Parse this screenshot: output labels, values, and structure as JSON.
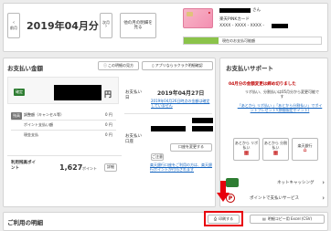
{
  "top": {
    "prev_month": "前月",
    "current_month": "2019年04月分",
    "next_month": "次月",
    "other_month": "他の月の明細を見る",
    "card_holder_suffix": "さん",
    "card_name": "楽天PINKカード",
    "card_number": "XXXX - XXXX - XXXX -",
    "card_status_text": "現在のお支払可能額"
  },
  "payment": {
    "title": "お支払い金額",
    "how_to_view_button": "この明細の見方",
    "app_button": "アプリならラクラク明細確認",
    "confirmed_badge": "確定",
    "yen": "円",
    "adjustment_badge": "残高",
    "adjustment_label": "調整額（キャンセル等）",
    "points_label": "ポイント支払い額",
    "cash_label": "現金支払",
    "zero_yen": "0 円",
    "points_title": "利用残高ポイント",
    "points_value": "1,627",
    "points_unit": "ポイント",
    "points_detail_button": "詳細",
    "due_date_label": "お支払い日",
    "due_date_value": "2019年04月27日",
    "due_note_link": "2019年04月26日時点の金額は確定していません",
    "account_label": "お支払い口座",
    "account_change_button": "口座を変更する",
    "account_detail_button": "ご注意",
    "bank_note_link": "楽天銀行口座をご利用の方は、楽天銀行ポイントが付与されます"
  },
  "support": {
    "title": "お支払いサポート",
    "alert_text": "04月分の金額変更は締め切りました",
    "info_text": "リボ払い、分割払いは05月分から変更可能です",
    "campaign_link": "「あとから リボ払い 」「あとから分割払い」でポイントプレゼント!(期間限定ポイント)",
    "tile_1": "あとから リボ払い",
    "tile_2": "あとから 分割払い",
    "tile_3": "楽天銀行",
    "net_cashing": "ネットキャッシング",
    "point_service": "ポイントで支払いサービス"
  },
  "details": {
    "title": "ご利用の明細",
    "print_button": "印刷する",
    "excel_button": "明細コピー用 Excel (CSV)"
  },
  "colors": {
    "brand_red": "#bf0000",
    "highlight_red": "#e8000d",
    "green": "#2e7d32",
    "link_blue": "#1565c0"
  }
}
